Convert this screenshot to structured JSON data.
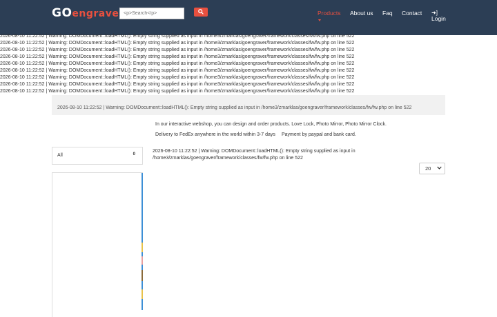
{
  "header": {
    "logo_go": "GO",
    "logo_engraver": "engraver",
    "search_placeholder": "<p>Search</p>",
    "nav": {
      "products": "Products",
      "about": "About us",
      "faq": "Faq",
      "contact": "Contact",
      "login": "Login"
    }
  },
  "warnings": [
    "2026-08-10 11:22:52 | Warning: DOMDocument::loadHTML(): Empty string supplied as input in /home3/zmarklas/goengraver/framework/classes/fw/fw.php on line 522",
    "2026-08-10 11:22:52 | Warning: DOMDocument::loadHTML(): Empty string supplied as input in /home3/zmarklas/goengraver/framework/classes/fw/fw.php on line 522",
    "2026-08-10 11:22:52 | Warning: DOMDocument::loadHTML(): Empty string supplied as input in /home3/zmarklas/goengraver/framework/classes/fw/fw.php on line 522",
    "2026-08-10 11:22:52 | Warning: DOMDocument::loadHTML(): Empty string supplied as input in /home3/zmarklas/goengraver/framework/classes/fw/fw.php on line 522",
    "2026-08-10 11:22:52 | Warning: DOMDocument::loadHTML(): Empty string supplied as input in /home3/zmarklas/goengraver/framework/classes/fw/fw.php on line 522",
    "2026-08-10 11:22:52 | Warning: DOMDocument::loadHTML(): Empty string supplied as input in /home3/zmarklas/goengraver/framework/classes/fw/fw.php on line 522",
    "2026-08-10 11:22:52 | Warning: DOMDocument::loadHTML(): Empty string supplied as input in /home3/zmarklas/goengraver/framework/classes/fw/fw.php on line 522",
    "2026-08-10 11:22:52 | Warning: DOMDocument::loadHTML(): Empty string supplied as input in /home3/zmarklas/goengraver/framework/classes/fw/fw.php on line 522",
    "2026-08-10 11:22:52 | Warning: DOMDocument::loadHTML(): Empty string supplied as input in /home3/zmarklas/goengraver/framework/classes/fw/fw.php on line 522"
  ],
  "warning_box": "2026-08-10 11:22:52 | Warning: DOMDocument::loadHTML(): Empty string supplied as input in /home3/zmarklas/goengraver/framework/classes/fw/fw.php on line 522",
  "intro_text": "In our interactive webshop, you can design and order products. Love Lock, Photo Mirror, Photo Mirror Clock.",
  "delivery_text": "Delivery to FedEx anywhere in the world within 3-7 days",
  "payment_text": "Payment by paypal and bank card.",
  "category": {
    "label": "All",
    "count": "0"
  },
  "main_warning": "2026-08-10 11:22:52 | Warning: DOMDocument::loadHTML(): Empty string supplied as input in /home3/zmarklas/goengraver/framework/classes/fw/fw.php on line 522",
  "per_page": {
    "selected": "20"
  },
  "colors": {
    "navbar": "#2c3e55",
    "accent": "#e8503f",
    "sidebar_line": "#3d8fd6"
  },
  "icons": {
    "search": "search-icon",
    "login": "sign-in-icon",
    "caret": "caret-down-icon"
  }
}
